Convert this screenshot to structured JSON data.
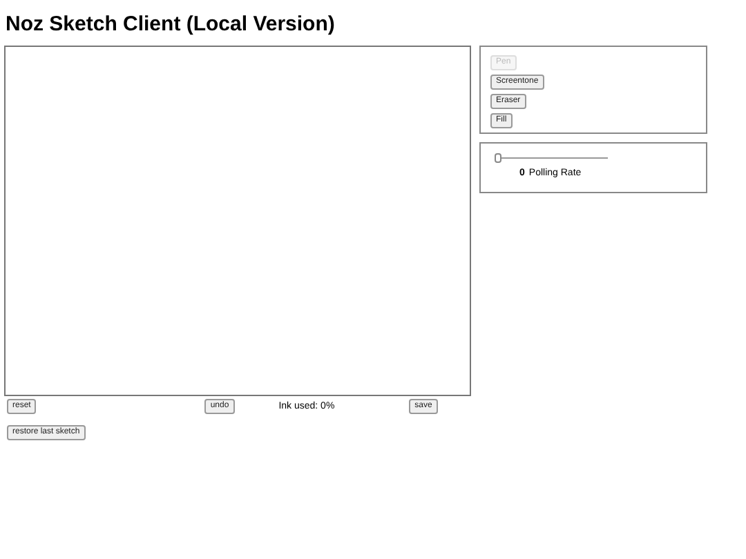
{
  "title": "Noz Sketch Client (Local Version)",
  "tools": [
    {
      "label": "Pen",
      "disabled": true
    },
    {
      "label": "Screentone",
      "disabled": false
    },
    {
      "label": "Eraser",
      "disabled": false
    },
    {
      "label": "Fill",
      "disabled": false
    }
  ],
  "polling": {
    "level": 0,
    "value": "0",
    "label": "Polling Rate"
  },
  "controls": {
    "reset": "reset",
    "undo": "undo",
    "ink": "Ink used: 0%",
    "save": "save",
    "restore": "restore last sketch"
  }
}
